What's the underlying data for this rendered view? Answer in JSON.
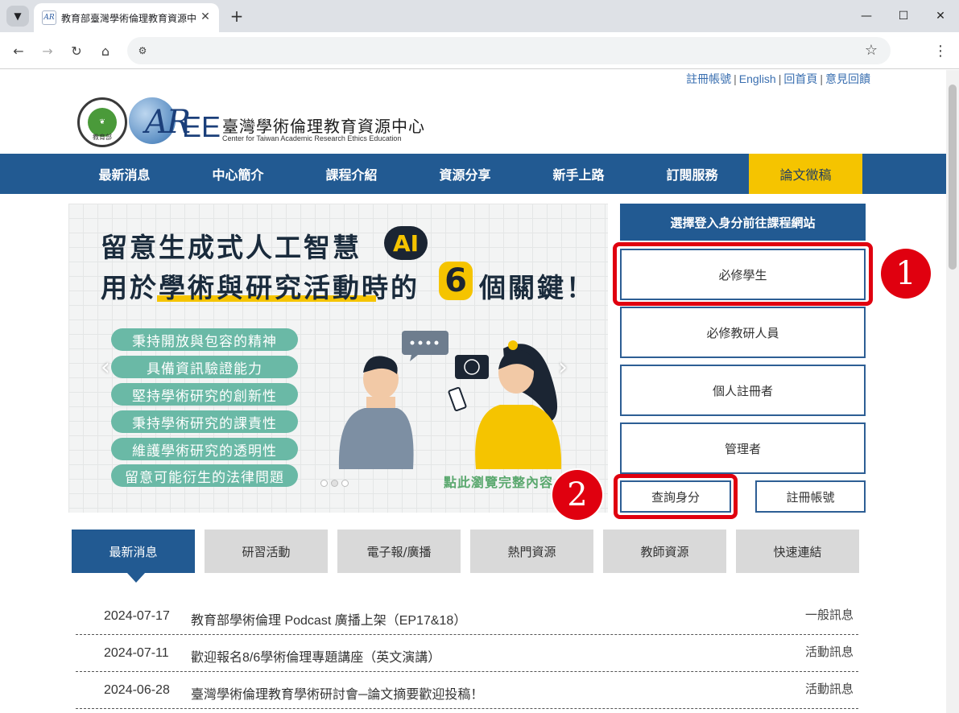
{
  "browser": {
    "tab_title": "教育部臺灣學術倫理教育資源中",
    "favicon_text": "AR",
    "icons": {
      "tab_menu": "chevron-down-icon",
      "close": "close-icon",
      "new_tab": "plus-icon",
      "back": "back-arrow-icon",
      "forward": "forward-arrow-icon",
      "reload": "reload-icon",
      "home": "home-icon",
      "site_info": "site-settings-icon",
      "bookmark": "star-icon",
      "menu": "kebab-menu-icon"
    }
  },
  "top_links": [
    "註冊帳號",
    "English",
    "回首頁",
    "意見回饋"
  ],
  "logo": {
    "seal_text": "教育部",
    "mark": "AR",
    "mark_rest": "EE",
    "title": "臺灣學術倫理教育資源中心",
    "subtitle": "Center for Taiwan Academic Research Ethics Education"
  },
  "nav": [
    "最新消息",
    "中心簡介",
    "課程介紹",
    "資源分享",
    "新手上路",
    "訂閱服務",
    "論文徵稿"
  ],
  "banner": {
    "headline_1": "留意生成式人工智慧",
    "ai_badge": "AI",
    "headline_2": "用於學術與研究活動時的",
    "six_badge": "6",
    "headline_2_end": "個關鍵！",
    "pills": [
      "秉持開放與包容的精神",
      "具備資訊驗證能力",
      "堅持學術研究的創新性",
      "秉持學術研究的課責性",
      "維護學術研究的透明性",
      "留意可能衍生的法律問題"
    ],
    "link_text": "點此瀏覽完整內容",
    "prev_arrow": "‹",
    "next_arrow": "›"
  },
  "login": {
    "heading": "選擇登入身分前往課程網站",
    "options": [
      "必修學生",
      "必修教研人員",
      "個人註冊者",
      "管理者"
    ],
    "query_button": "查詢身分",
    "register_button": "註冊帳號"
  },
  "annotations": {
    "marker_1": "1",
    "marker_2": "2",
    "color": "#e0000f"
  },
  "content_tabs": [
    "最新消息",
    "研習活動",
    "電子報/廣播",
    "熱門資源",
    "教師資源",
    "快速連結"
  ],
  "news": [
    {
      "date": "2024-07-17",
      "title": "教育部學術倫理 Podcast 廣播上架（EP17&18）",
      "category": "一般訊息"
    },
    {
      "date": "2024-07-11",
      "title": "歡迎報名8/6學術倫理專題講座（英文演講）",
      "category": "活動訊息"
    },
    {
      "date": "2024-06-28",
      "title": "臺灣學術倫理教育學術研討會─論文摘要歡迎投稿！",
      "category": "活動訊息"
    }
  ],
  "colors": {
    "primary": "#225a92",
    "accent": "#f5c400",
    "pill": "#6ab9a6"
  }
}
